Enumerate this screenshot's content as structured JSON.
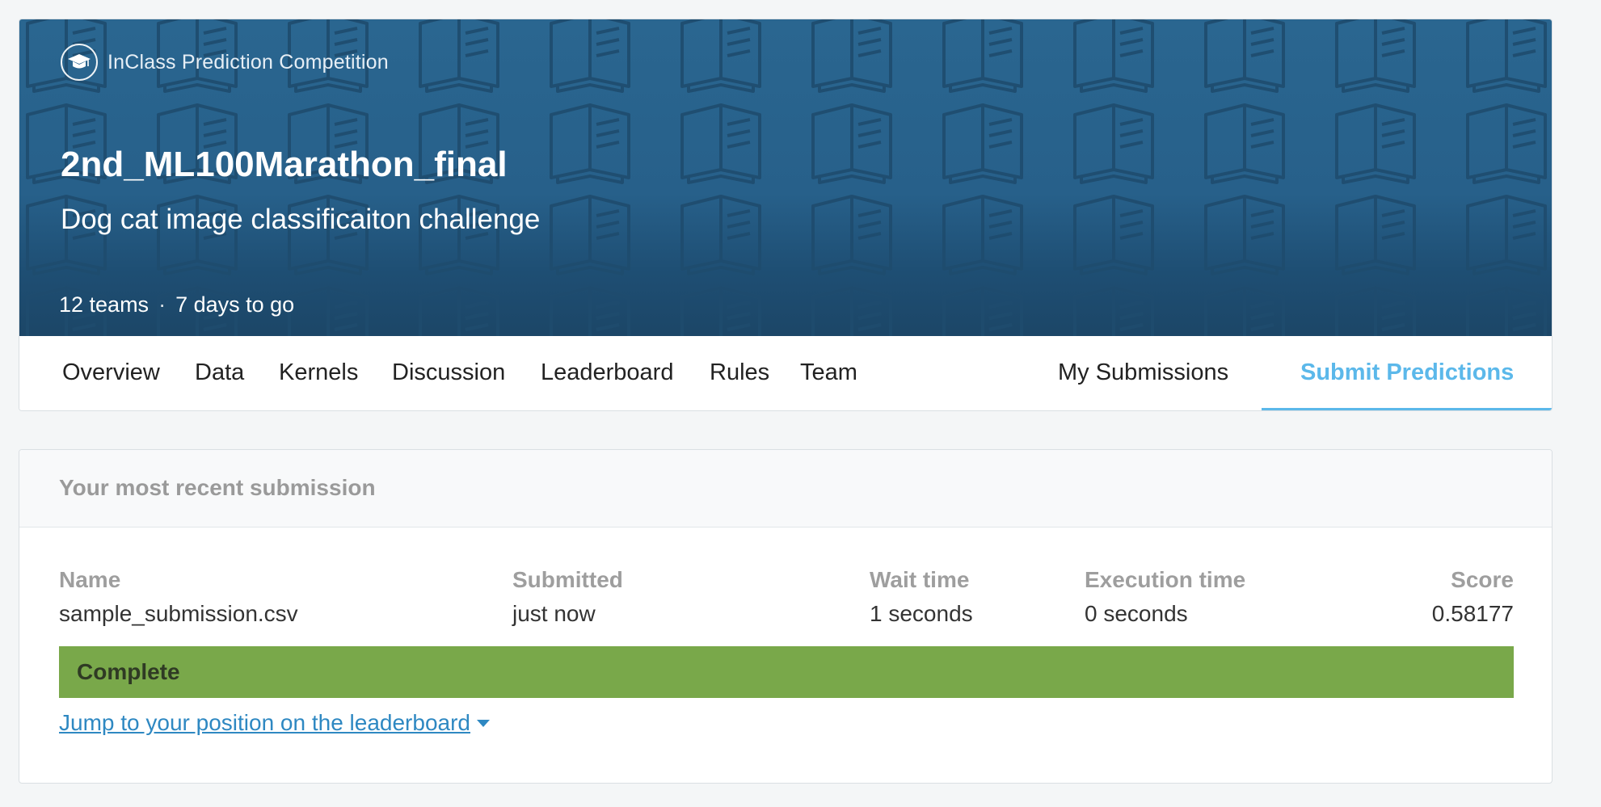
{
  "competition": {
    "type_label": "InClass Prediction Competition",
    "title": "2nd_ML100Marathon_final",
    "subtitle": "Dog cat image classificaiton challenge",
    "teams": "12 teams",
    "separator": "·",
    "deadline": "7 days to go",
    "icons": {
      "badge": "graduation-cap-icon",
      "pattern": "open-book-icon"
    }
  },
  "nav": {
    "items": [
      {
        "label": "Overview"
      },
      {
        "label": "Data"
      },
      {
        "label": "Kernels"
      },
      {
        "label": "Discussion"
      },
      {
        "label": "Leaderboard"
      },
      {
        "label": "Rules"
      },
      {
        "label": "Team"
      }
    ],
    "my_submissions": "My Submissions",
    "submit_predictions": "Submit Predictions",
    "active": "Submit Predictions"
  },
  "submission": {
    "heading": "Your most recent submission",
    "columns": {
      "name": "Name",
      "submitted": "Submitted",
      "wait_time": "Wait time",
      "execution_time": "Execution time",
      "score": "Score"
    },
    "values": {
      "name": "sample_submission.csv",
      "submitted": "just now",
      "wait_time": "1 seconds",
      "execution_time": "0 seconds",
      "score": "0.58177"
    },
    "status": "Complete",
    "jump_link": "Jump to your position on the leaderboard"
  },
  "colors": {
    "banner": "#27608a",
    "accent": "#5bb8ea",
    "status_complete": "#79a84a",
    "link": "#2e88c2"
  }
}
